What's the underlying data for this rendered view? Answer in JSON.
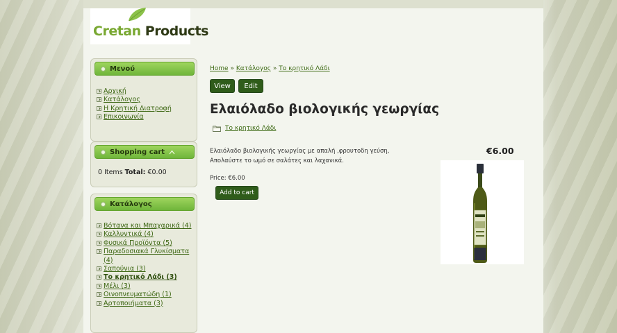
{
  "site": {
    "logo_part1": "Cretan",
    "logo_part2": "Products"
  },
  "sidebar": {
    "menu": {
      "title": "Μενού",
      "items": [
        {
          "label": "Αρχική"
        },
        {
          "label": "Κατάλογος"
        },
        {
          "label": "Η Κρητική Διατροφή"
        },
        {
          "label": "Επικοινωνία"
        }
      ]
    },
    "cart": {
      "title": "Shopping cart",
      "items_text": "0 Items",
      "total_label": "Total:",
      "total_value": "€0.00"
    },
    "catalog": {
      "title": "Κατάλογος",
      "items": [
        {
          "label": "Βότανα και Μπαχαρικά (4)"
        },
        {
          "label": "Καλλυντικά (4)"
        },
        {
          "label": "Φυσικά Προϊόντα (5)"
        },
        {
          "label": "Παραδοσιακά Γλυκίσματα"
        },
        {
          "label": "(4)"
        },
        {
          "label": "Σαπούνια (3)"
        },
        {
          "label": "Το κρητικό Λάδι (3)"
        },
        {
          "label": "Μέλι (3)"
        },
        {
          "label": "Οινοπνευματώδη (1)"
        },
        {
          "label": "Αρτοποιήματα (3)"
        }
      ]
    }
  },
  "main": {
    "breadcrumb": {
      "home": "Home",
      "sep": "»",
      "catalog": "Κατάλογος",
      "current": "Το κρητικό Λάδι"
    },
    "tabs": {
      "view": "View",
      "edit": "Edit"
    },
    "title": "Ελαιόλαδο βιολογικής γεωργίας",
    "term": "Το κρητικό Λάδι",
    "description_line1": "Ελαιόλαδο βιολογικής γεωργίας με απαλή ,φρουτοδη γεύση,",
    "description_line2": "Απολαύστε το ωμό σε σαλάτες και λαχανικά.",
    "price_display": "€6.00",
    "price_label": "Price:",
    "price_value": "€6.00",
    "add_to_cart": "Add to cart"
  },
  "colors": {
    "accent_green": "#6fb53a",
    "button_dark_green": "#2f5c1a",
    "link_green": "#3d6a14"
  },
  "icons": {
    "leaf": "leaf-icon",
    "folder": "folder-icon",
    "collapse": "caret-up-icon"
  }
}
